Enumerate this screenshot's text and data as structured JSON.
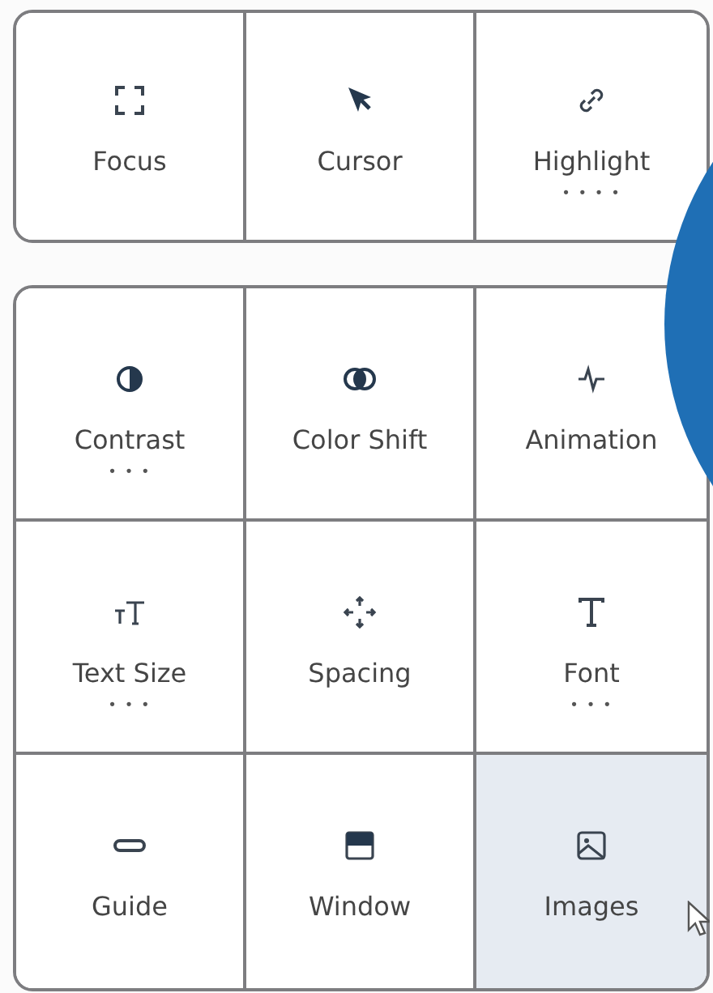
{
  "panels": [
    {
      "items": [
        {
          "label": "Focus",
          "selected": false
        },
        {
          "label": "Cursor",
          "selected": false
        },
        {
          "label": "Highlight",
          "dots": "• • • •",
          "selected": false
        }
      ]
    },
    {
      "items": [
        {
          "label": "Contrast",
          "dots": "• • •",
          "selected": false
        },
        {
          "label": "Color Shift",
          "selected": false
        },
        {
          "label": "Animation",
          "selected": false
        },
        {
          "label": "Text Size",
          "dots": "• • •",
          "selected": false
        },
        {
          "label": "Spacing",
          "selected": false
        },
        {
          "label": "Font",
          "dots": "• • •",
          "selected": false
        },
        {
          "label": "Guide",
          "selected": false
        },
        {
          "label": "Window",
          "selected": false
        },
        {
          "label": "Images",
          "selected": true
        }
      ]
    }
  ]
}
